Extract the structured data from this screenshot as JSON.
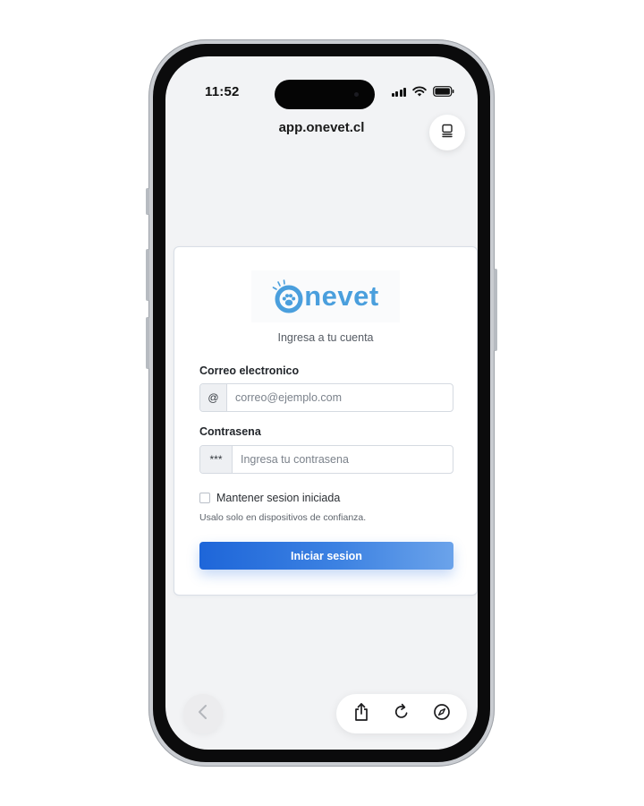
{
  "status_bar": {
    "time": "11:52"
  },
  "browser": {
    "url": "app.onevet.cl"
  },
  "login": {
    "logo_text": "nevet",
    "subtitle": "Ingresa a tu cuenta",
    "email": {
      "label": "Correo electronico",
      "addon": "@",
      "placeholder": "correo@ejemplo.com"
    },
    "password": {
      "label": "Contrasena",
      "addon": "***",
      "placeholder": "Ingresa tu contrasena"
    },
    "remember": {
      "label": "Mantener sesion iniciada",
      "checked": false,
      "hint": "Usalo solo en dispositivos de confianza."
    },
    "submit_label": "Iniciar sesion"
  },
  "colors": {
    "accent": "#2a72dd",
    "logo": "#4a9fdd",
    "screen_bg": "#f2f3f5"
  },
  "icons": {
    "tabs": "tabs-icon",
    "back": "chevron-left-icon",
    "share": "share-icon",
    "reload": "reload-icon",
    "compass": "compass-icon"
  }
}
